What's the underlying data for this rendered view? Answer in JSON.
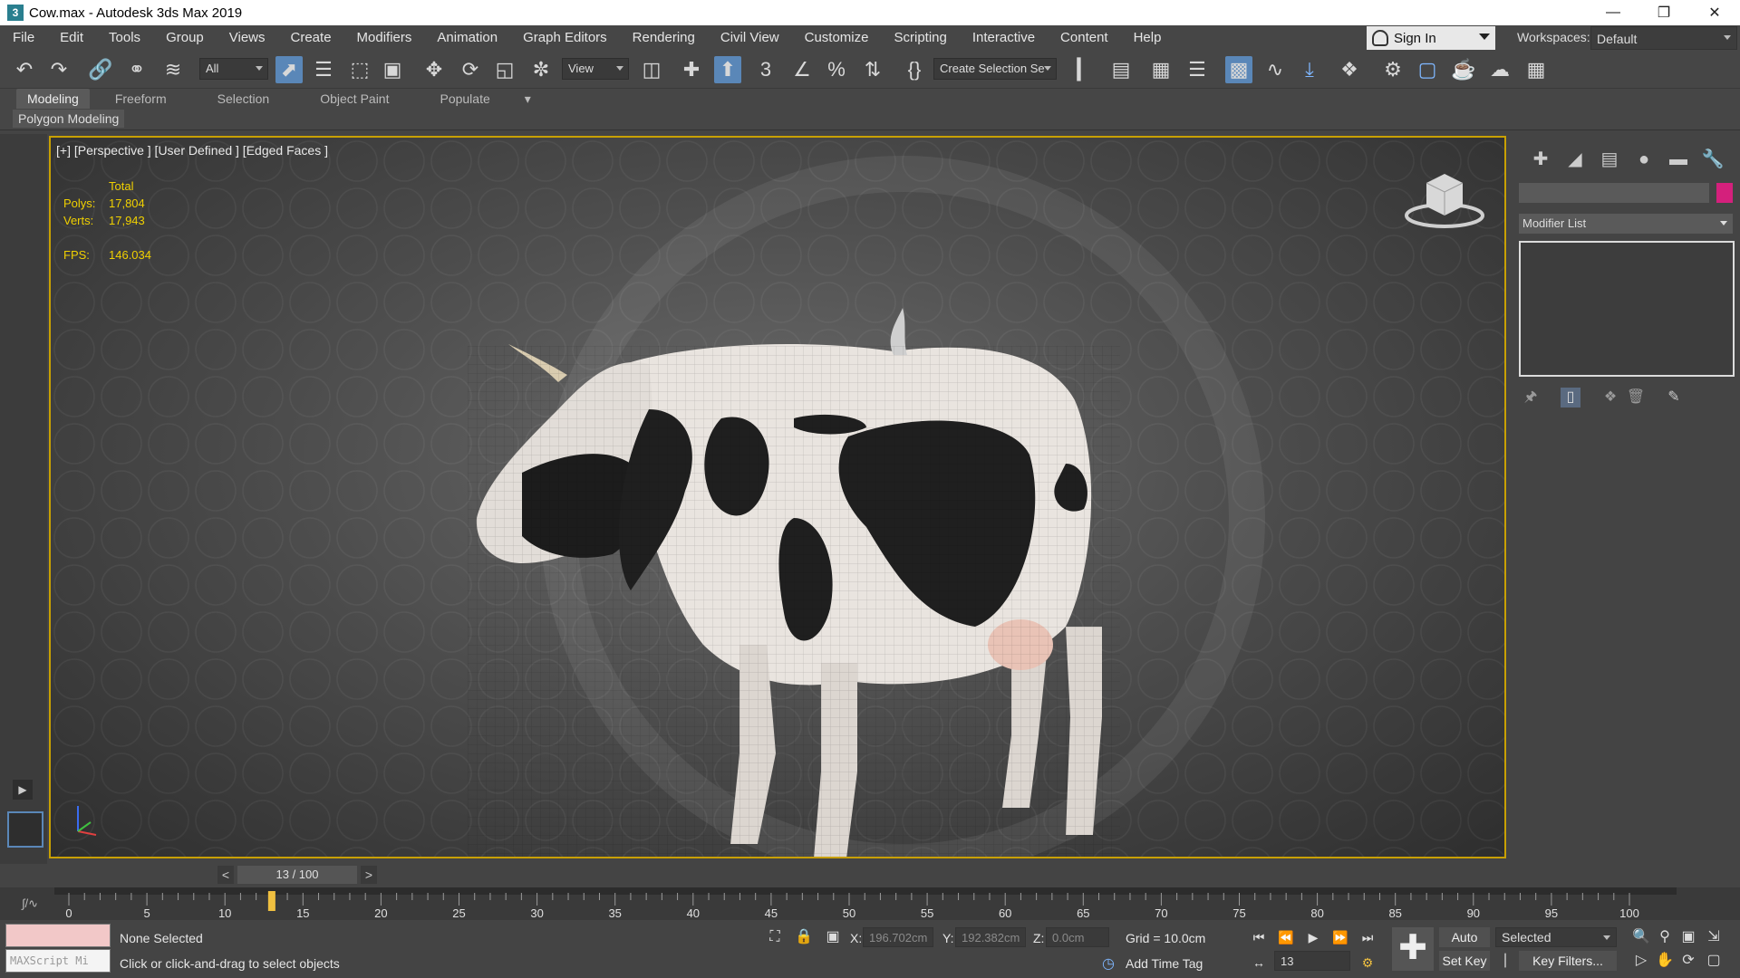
{
  "window": {
    "title": "Cow.max - Autodesk 3ds Max 2019",
    "app_icon": "3",
    "controls": [
      "minimize-icon",
      "restore-icon",
      "close-icon"
    ]
  },
  "menu": [
    "File",
    "Edit",
    "Tools",
    "Group",
    "Views",
    "Create",
    "Modifiers",
    "Animation",
    "Graph Editors",
    "Rendering",
    "Civil View",
    "Customize",
    "Scripting",
    "Interactive",
    "Content",
    "Help"
  ],
  "account": {
    "sign_in": "Sign In",
    "workspaces_label": "Workspaces:",
    "workspace": "Default"
  },
  "toolbar": {
    "filter": "All",
    "ref_coord": "View",
    "named_selection": "Create Selection Se"
  },
  "ribbon": {
    "tabs": [
      "Modeling",
      "Freeform",
      "Selection",
      "Object Paint",
      "Populate"
    ],
    "active": "Modeling",
    "panel": "Polygon Modeling"
  },
  "viewport": {
    "label": "[+] [Perspective ] [User Defined ] [Edged Faces ]",
    "stats": {
      "header": "Total",
      "polys_label": "Polys:",
      "polys": "17,804",
      "verts_label": "Verts:",
      "verts": "17,943",
      "fps_label": "FPS:",
      "fps": "146.034"
    },
    "border_color": "#c8a000"
  },
  "command_panel": {
    "modifier_list": "Modifier List",
    "object_color": "#d4207c"
  },
  "timeline": {
    "frame": "13 / 100",
    "current": 13,
    "end": 100,
    "ticks": [
      0,
      5,
      10,
      15,
      20,
      25,
      30,
      35,
      40,
      45,
      50,
      55,
      60,
      65,
      70,
      75,
      80,
      85,
      90,
      95,
      100
    ]
  },
  "status": {
    "selection": "None Selected",
    "prompt": "Click or click-and-drag to select objects",
    "maxscript": "MAXScript Mi",
    "x_label": "X:",
    "x": "196.702cm",
    "y_label": "Y:",
    "y": "192.382cm",
    "z_label": "Z:",
    "z": "0.0cm",
    "grid": "Grid = 10.0cm",
    "add_time_tag": "Add Time Tag",
    "auto_key": "Auto Key",
    "set_key": "Set Key",
    "key_mode": "Selected",
    "key_filters": "Key Filters...",
    "current_frame": "13"
  }
}
